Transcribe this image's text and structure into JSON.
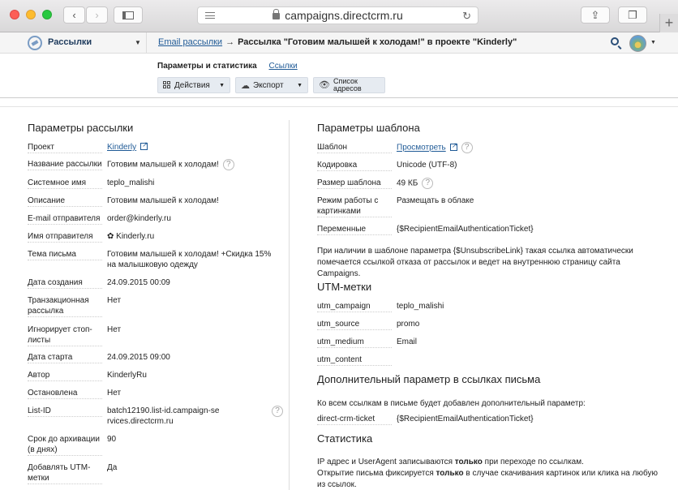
{
  "browser": {
    "url": "campaigns.directcrm.ru",
    "back_icon": "chevron-left-icon",
    "forward_icon": "chevron-right-icon",
    "newtab_label": "+"
  },
  "header": {
    "app_name": "Рассылки",
    "breadcrumb_link": "Email рассылки",
    "breadcrumb_arrow": "→",
    "breadcrumb_current": "Рассылка \"Готовим малышей к холодам!\" в проекте \"Kinderly\""
  },
  "subheader": {
    "tab_active": "Параметры и статистика",
    "tab_link": "Ссылки",
    "actions_label": "Действия",
    "export_label": "Экспорт",
    "list_label_1": "Список",
    "list_label_2": "адресов"
  },
  "left": {
    "title": "Параметры рассылки",
    "rows": [
      {
        "label": "Проект",
        "value": "Kinderly"
      },
      {
        "label": "Название рассылки",
        "value": "Готовим малышей к холодам!"
      },
      {
        "label": "Системное имя",
        "value": "teplo_malishi"
      },
      {
        "label": "Описание",
        "value": "Готовим малышей к холодам!"
      },
      {
        "label": "E-mail отправителя",
        "value": "order@kinderly.ru"
      },
      {
        "label": "Имя отправителя",
        "value": "✿ Kinderly.ru"
      },
      {
        "label": "Тема письма",
        "value": "Готовим малышей к холодам! +Скидка 15% на малышковую одежду"
      },
      {
        "label": "Дата создания",
        "value": "24.09.2015 00:09"
      },
      {
        "label": "Транзакционная рассылка",
        "value": "Нет"
      },
      {
        "label": "Игнорирует стоп-листы",
        "value": "Нет"
      },
      {
        "label": "Дата старта",
        "value": "24.09.2015 09:00"
      },
      {
        "label": "Автор",
        "value": "KinderlyRu"
      },
      {
        "label": "Остановлена",
        "value": "Нет"
      },
      {
        "label": "List-ID",
        "value": "batch12190.list-id.campaign-services.directcrm.ru"
      },
      {
        "label": "Срок до архивации (в днях)",
        "value": "90"
      },
      {
        "label": "Добавлять UTM-метки",
        "value": "Да"
      }
    ]
  },
  "right": {
    "template_title": "Параметры шаблона",
    "template_rows": [
      {
        "label": "Шаблон",
        "value": "Просмотреть"
      },
      {
        "label": "Кодировка",
        "value": "Unicode (UTF-8)"
      },
      {
        "label": "Размер шаблона",
        "value": "49 КБ"
      },
      {
        "label": "Режим работы с картинками",
        "value": "Размещать в облаке"
      },
      {
        "label": "Переменные",
        "value": "{$RecipientEmailAuthenticationTicket}"
      }
    ],
    "unsubscribe_note": "При наличии в шаблоне параметра {$UnsubscribeLink} такая ссылка автоматически помечается ссылкой отказа от рассылок и ведет на внутреннюю страницу сайта Campaigns.",
    "utm_title": "UTM-метки",
    "utm_rows": [
      {
        "label": "utm_campaign",
        "value": "teplo_malishi"
      },
      {
        "label": "utm_source",
        "value": "promo"
      },
      {
        "label": "utm_medium",
        "value": "Email"
      },
      {
        "label": "utm_content",
        "value": ""
      }
    ],
    "extra_title": "Дополнительный параметр в ссылках письма",
    "extra_note": "Ко всем ссылкам в письме будет добавлен дополнительный параметр:",
    "extra_row": {
      "label": "direct-crm-ticket",
      "value": "{$RecipientEmailAuthenticationTicket}"
    },
    "stats_title": "Статистика",
    "stats_line1_a": "IP адрес и UserAgent записываются ",
    "stats_line1_b": "только",
    "stats_line1_c": " при переходе по ссылкам.",
    "stats_line2_a": "Открытие письма фиксируется ",
    "stats_line2_b": "только",
    "stats_line2_c": " в случае скачивания картинок или клика на любую из ссылок."
  },
  "help_glyph": "?"
}
